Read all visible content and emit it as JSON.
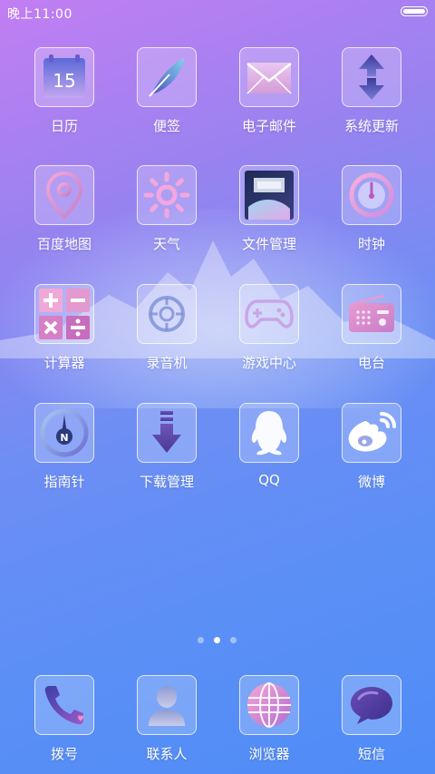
{
  "status_bar": {
    "time": "晚上11:00"
  },
  "home_grid": [
    {
      "label": "日历",
      "icon": "calendar-icon",
      "badge": "15"
    },
    {
      "label": "便签",
      "icon": "feather-icon"
    },
    {
      "label": "电子邮件",
      "icon": "envelope-icon"
    },
    {
      "label": "系统更新",
      "icon": "update-arrows-icon"
    },
    {
      "label": "百度地图",
      "icon": "map-pin-icon"
    },
    {
      "label": "天气",
      "icon": "sun-icon"
    },
    {
      "label": "文件管理",
      "icon": "file-manager-icon"
    },
    {
      "label": "时钟",
      "icon": "clock-icon"
    },
    {
      "label": "计算器",
      "icon": "calculator-icon"
    },
    {
      "label": "录音机",
      "icon": "recorder-icon"
    },
    {
      "label": "游戏中心",
      "icon": "gamepad-icon"
    },
    {
      "label": "电台",
      "icon": "radio-icon"
    },
    {
      "label": "指南针",
      "icon": "compass-icon",
      "badge": "N"
    },
    {
      "label": "下载管理",
      "icon": "download-arrow-icon"
    },
    {
      "label": "QQ",
      "icon": "qq-penguin-icon"
    },
    {
      "label": "微博",
      "icon": "weibo-icon"
    }
  ],
  "page_indicator": {
    "pages": 3,
    "current": 2
  },
  "dock": [
    {
      "label": "拨号",
      "icon": "phone-icon"
    },
    {
      "label": "联系人",
      "icon": "contact-person-icon"
    },
    {
      "label": "浏览器",
      "icon": "globe-icon"
    },
    {
      "label": "短信",
      "icon": "chat-bubble-icon"
    }
  ]
}
